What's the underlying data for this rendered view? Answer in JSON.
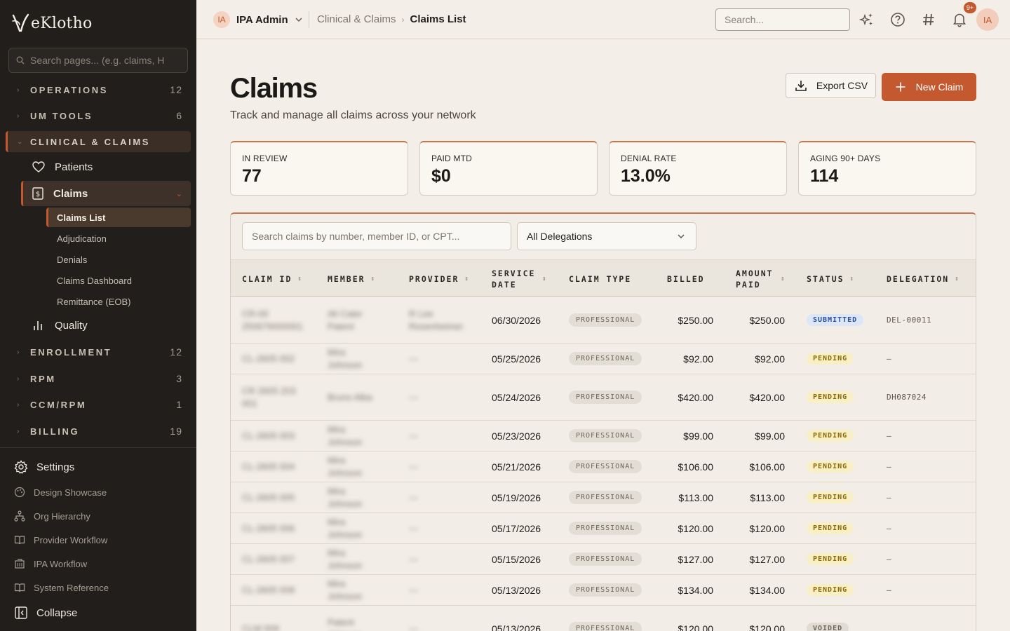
{
  "brand": {
    "name": "eKlotho",
    "accent": "#c4582e"
  },
  "sidebar": {
    "search_placeholder": "Search pages... (e.g. claims, H",
    "groups": [
      {
        "label": "OPERATIONS",
        "count": "12"
      },
      {
        "label": "UM TOOLS",
        "count": "6"
      },
      {
        "label": "CLINICAL & CLAIMS",
        "count": ""
      },
      {
        "label": "ENROLLMENT",
        "count": "12"
      },
      {
        "label": "RPM",
        "count": "3"
      },
      {
        "label": "CCM/RPM",
        "count": "1"
      },
      {
        "label": "BILLING",
        "count": "19"
      }
    ],
    "items": [
      {
        "label": "Patients",
        "icon": "heart-icon"
      },
      {
        "label": "Claims",
        "icon": "document-dollar-icon"
      },
      {
        "label": "Quality",
        "icon": "bar-chart-icon"
      }
    ],
    "sub_items": [
      "Claims List",
      "Adjudication",
      "Denials",
      "Claims Dashboard",
      "Remittance (EOB)"
    ],
    "bottom": [
      {
        "label": "Settings",
        "icon": "gear-icon"
      },
      {
        "label": "Design Showcase",
        "icon": "palette-icon"
      },
      {
        "label": "Org Hierarchy",
        "icon": "hierarchy-icon"
      },
      {
        "label": "Provider Workflow",
        "icon": "book-icon"
      },
      {
        "label": "IPA Workflow",
        "icon": "building-icon"
      },
      {
        "label": "System Reference",
        "icon": "book-icon"
      },
      {
        "label": "Collapse",
        "icon": "collapse-icon"
      }
    ]
  },
  "topbar": {
    "org_initials": "IA",
    "org_name": "IPA Admin",
    "breadcrumb": {
      "parent": "Clinical & Claims",
      "current": "Claims List"
    },
    "search_placeholder": "Search...",
    "notification_badge": "9+",
    "user_initials": "IA"
  },
  "page": {
    "title": "Claims",
    "subtitle": "Track and manage all claims across your network",
    "export_label": "Export CSV",
    "new_label": "New Claim"
  },
  "stats": [
    {
      "label": "IN REVIEW",
      "value": "77"
    },
    {
      "label": "PAID MTD",
      "value": "$0"
    },
    {
      "label": "DENIAL RATE",
      "value": "13.0%"
    },
    {
      "label": "AGING 90+ DAYS",
      "value": "114"
    }
  ],
  "table": {
    "search_placeholder": "Search claims by number, member ID, or CPT...",
    "delegation_filter": "All Delegations",
    "columns": [
      "CLAIM ID",
      "MEMBER",
      "PROVIDER",
      "SERVICE DATE",
      "CLAIM TYPE",
      "BILLED",
      "AMOUNT PAID",
      "STATUS",
      "DELEGATION"
    ],
    "rows": [
      {
        "claim_id": "CR-00 250679000001",
        "member": "Ali Cater Patent",
        "provider": "R Lee Rosenheimer",
        "date": "06/30/2026",
        "type": "PROFESSIONAL",
        "billed": "$250.00",
        "paid": "$250.00",
        "status": "SUBMITTED",
        "delegation": "DEL-00011"
      },
      {
        "claim_id": "CL-2605 002",
        "member": "Mira Johnson",
        "provider": "—",
        "date": "05/25/2026",
        "type": "PROFESSIONAL",
        "billed": "$92.00",
        "paid": "$92.00",
        "status": "PENDING",
        "delegation": "—"
      },
      {
        "claim_id": "CR 2605 203 001",
        "member": "Bruno Alba",
        "provider": "—",
        "date": "05/24/2026",
        "type": "PROFESSIONAL",
        "billed": "$420.00",
        "paid": "$420.00",
        "status": "PENDING",
        "delegation": "DH087024"
      },
      {
        "claim_id": "CL-2605 003",
        "member": "Mira Johnson",
        "provider": "—",
        "date": "05/23/2026",
        "type": "PROFESSIONAL",
        "billed": "$99.00",
        "paid": "$99.00",
        "status": "PENDING",
        "delegation": "—"
      },
      {
        "claim_id": "CL-2605 004",
        "member": "Mira Johnson",
        "provider": "—",
        "date": "05/21/2026",
        "type": "PROFESSIONAL",
        "billed": "$106.00",
        "paid": "$106.00",
        "status": "PENDING",
        "delegation": "—"
      },
      {
        "claim_id": "CL-2605 005",
        "member": "Mira Johnson",
        "provider": "—",
        "date": "05/19/2026",
        "type": "PROFESSIONAL",
        "billed": "$113.00",
        "paid": "$113.00",
        "status": "PENDING",
        "delegation": "—"
      },
      {
        "claim_id": "CL-2605 006",
        "member": "Mira Johnson",
        "provider": "—",
        "date": "05/17/2026",
        "type": "PROFESSIONAL",
        "billed": "$120.00",
        "paid": "$120.00",
        "status": "PENDING",
        "delegation": "—"
      },
      {
        "claim_id": "CL-2605 007",
        "member": "Mira Johnson",
        "provider": "—",
        "date": "05/15/2026",
        "type": "PROFESSIONAL",
        "billed": "$127.00",
        "paid": "$127.00",
        "status": "PENDING",
        "delegation": "—"
      },
      {
        "claim_id": "CL-2605 008",
        "member": "Mira Johnson",
        "provider": "—",
        "date": "05/13/2026",
        "type": "PROFESSIONAL",
        "billed": "$134.00",
        "paid": "$134.00",
        "status": "PENDING",
        "delegation": "—"
      },
      {
        "claim_id": "CLM 009",
        "member": "Patent Johnson",
        "provider": "—",
        "date": "05/13/2026",
        "type": "PROFESSIONAL",
        "billed": "$120.00",
        "paid": "$120.00",
        "status": "VOIDED",
        "delegation": ""
      }
    ]
  },
  "status_colors": {
    "SUBMITTED": {
      "bg": "#dde6f7",
      "fg": "#2c4f9a"
    },
    "PENDING": {
      "bg": "#f8efc4",
      "fg": "#8a6a08"
    },
    "VOIDED": {
      "bg": "#e0dbd3",
      "fg": "#6d665c"
    }
  }
}
